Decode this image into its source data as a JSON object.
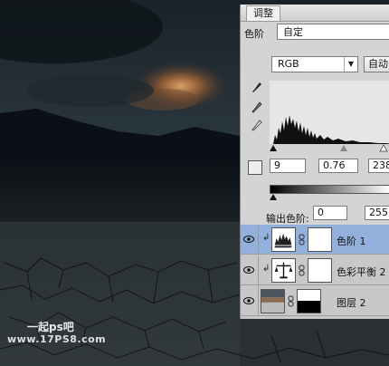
{
  "panel": {
    "title": "调整",
    "preset_label": "色阶",
    "preset_value": "自定",
    "channel": "RGB",
    "auto_label": "自动"
  },
  "levels": {
    "input_black": "9",
    "input_gamma": "0.76",
    "input_white": "238",
    "output_label": "输出色阶:",
    "output_black": "0",
    "output_white": "255"
  },
  "layers": [
    {
      "name": "色阶 1",
      "type": "levels-adjustment",
      "selected": true
    },
    {
      "name": "色彩平衡 2",
      "type": "color-balance-adjustment",
      "selected": false
    },
    {
      "name": "图层 2",
      "type": "pixel-layer",
      "selected": false
    }
  ],
  "watermark": {
    "line1": "一起ps吧",
    "line2": "www.17PS8.com"
  },
  "colors": {
    "panel_bg": "#d4d4d4",
    "selected_row": "#93b0dd"
  }
}
